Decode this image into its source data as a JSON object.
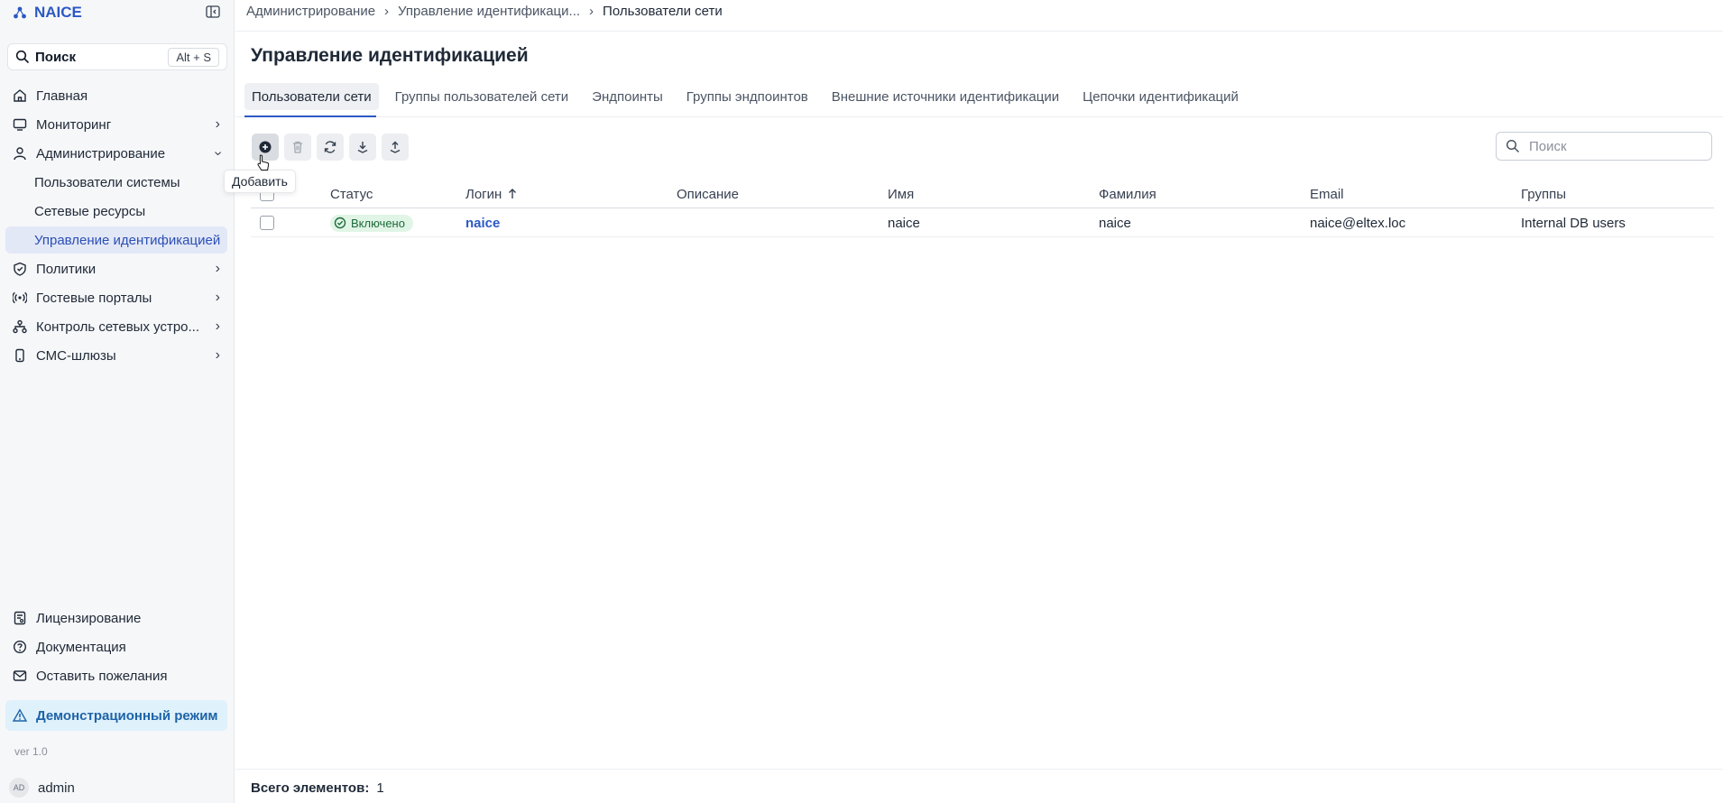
{
  "app": {
    "name": "NAICE"
  },
  "sidebar": {
    "search_label": "Поиск",
    "search_shortcut": "Alt + S",
    "items": [
      {
        "label": "Главная",
        "icon": "home-icon",
        "has_children": false
      },
      {
        "label": "Мониторинг",
        "icon": "monitor-icon",
        "has_children": true
      },
      {
        "label": "Администрирование",
        "icon": "user-icon",
        "expanded": true
      },
      {
        "label": "Политики",
        "icon": "shield-check-icon",
        "has_children": true
      },
      {
        "label": "Гостевые порталы",
        "icon": "broadcast-icon",
        "has_children": true
      },
      {
        "label": "Контроль сетевых устро...",
        "icon": "network-icon",
        "has_children": true
      },
      {
        "label": "СМС-шлюзы",
        "icon": "phone-icon",
        "has_children": true
      }
    ],
    "sub_items": [
      {
        "label": "Пользователи системы",
        "active": false
      },
      {
        "label": "Сетевые ресурсы",
        "active": false
      },
      {
        "label": "Управление идентификацией",
        "active": true
      }
    ],
    "bottom": [
      {
        "label": "Лицензирование",
        "icon": "license-icon"
      },
      {
        "label": "Документация",
        "icon": "help-circle-icon"
      },
      {
        "label": "Оставить пожелания",
        "icon": "mail-icon"
      }
    ],
    "demo_label": "Демонстрационный режим",
    "version": "ver 1.0",
    "user": {
      "initials": "AD",
      "name": "admin"
    }
  },
  "breadcrumb": [
    "Администрирование",
    "Управление идентификаци...",
    "Пользователи сети"
  ],
  "page_title": "Управление идентификацией",
  "tabs": [
    "Пользователи сети",
    "Группы пользователей сети",
    "Эндпоинты",
    "Группы эндпоинтов",
    "Внешние источники идентификации",
    "Цепочки идентификаций"
  ],
  "toolbar": {
    "add_tooltip": "Добавить"
  },
  "search": {
    "placeholder": "Поиск"
  },
  "table": {
    "columns": [
      "Статус",
      "Логин",
      "Описание",
      "Имя",
      "Фамилия",
      "Email",
      "Группы"
    ],
    "rows": [
      {
        "status": "Включено",
        "login": "naice",
        "description": "",
        "first_name": "naice",
        "last_name": "naice",
        "email": "naice@eltex.loc",
        "groups": "Internal DB users"
      }
    ]
  },
  "footer": {
    "total_label": "Всего элементов:",
    "total_value": "1"
  },
  "colors": {
    "accent": "#2b59c3",
    "status_ok": "#1d6b3a",
    "demo_bg": "#dff1fb"
  }
}
